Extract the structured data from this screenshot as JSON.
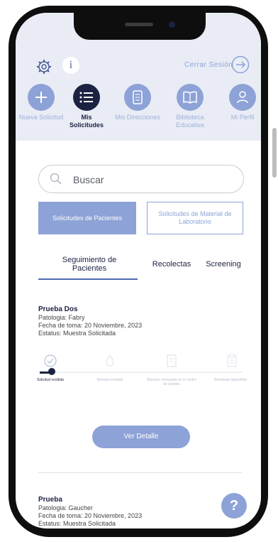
{
  "header": {
    "logout_label": "Cerrar Sesión",
    "info_glyph": "i",
    "icons": {
      "settings": "gear-icon",
      "info": "info-icon",
      "logout": "arrow-right-circle-icon"
    }
  },
  "nav": [
    {
      "label": "Nueva Solicitud",
      "icon": "plus-icon",
      "active": false
    },
    {
      "label": "Mis Solicitudes",
      "icon": "list-icon",
      "active": true
    },
    {
      "label": "Mis Direcciones",
      "icon": "map-list-icon",
      "active": false
    },
    {
      "label": "Biblioteca Educativa",
      "icon": "book-icon",
      "active": false
    },
    {
      "label": "Mi Perfil",
      "icon": "user-icon",
      "active": false
    }
  ],
  "search": {
    "placeholder": "Buscar",
    "value": ""
  },
  "segments": {
    "patients": "Solicitudes de Pacientes",
    "lab_material": "Solicitudes de Material de Laboratorio"
  },
  "tabs": [
    {
      "label": "Seguimiento de Pacientes",
      "active": true
    },
    {
      "label": "Recolectas",
      "active": false
    },
    {
      "label": "Screening",
      "active": false
    }
  ],
  "requests": [
    {
      "name": "Prueba Dos",
      "pathology": "Patologia: Fabry",
      "date": "Fecha de toma: 20 Noviembre, 2023",
      "status": "Estatus: Muestra Solicitada"
    },
    {
      "name": "Prueba",
      "pathology": "Patologia: Gaucher",
      "date": "Fecha de toma: 20 Noviembre, 2023",
      "status": "Estatus: Muestra Solicitada"
    }
  ],
  "progress": {
    "steps": [
      {
        "label": "Solicitud recibida",
        "icon": "check-circle-icon"
      },
      {
        "label": "Muestra enviada",
        "icon": "drop-icon"
      },
      {
        "label": "Muestra entregada en el centro de análisis",
        "icon": "document-icon"
      },
      {
        "label": "Resultado disponible",
        "icon": "clipboard-icon"
      }
    ],
    "current_step": 1,
    "fraction": 0.06
  },
  "detail_button": "Ver Detalle",
  "help_glyph": "?",
  "colors": {
    "primary_dark": "#1b2242",
    "accent": "#8da2d6",
    "header_bg": "#e9ecf5"
  }
}
